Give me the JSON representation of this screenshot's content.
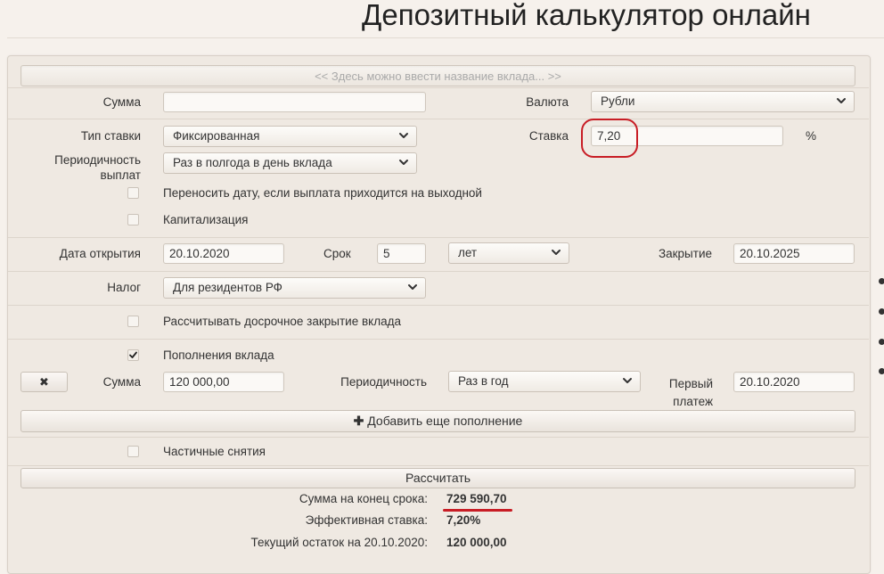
{
  "page": {
    "title": "Депозитный калькулятор онлайн"
  },
  "deposit_name": {
    "placeholder": "<< Здесь можно ввести название вклада... >>"
  },
  "sum": {
    "label": "Сумма",
    "value": ""
  },
  "currency": {
    "label": "Валюта",
    "value": "Рубли"
  },
  "rate_type": {
    "label": "Тип ставки",
    "value": "Фиксированная"
  },
  "rate": {
    "label": "Ставка",
    "value": "7,20",
    "unit": "%"
  },
  "payout": {
    "label_line1": "Периодичность",
    "label_line2": "выплат",
    "value": "Раз в полгода в день вклада"
  },
  "move_date": {
    "label": "Переносить дату, если выплата приходится на выходной",
    "checked": false
  },
  "capitalization": {
    "label": "Капитализация",
    "checked": false
  },
  "open_date": {
    "label": "Дата открытия",
    "value": "20.10.2020"
  },
  "term": {
    "label": "Срок",
    "value": "5",
    "unit": "лет"
  },
  "close_date": {
    "label": "Закрытие",
    "value": "20.10.2025"
  },
  "tax": {
    "label": "Налог",
    "value": "Для резидентов РФ"
  },
  "early_close": {
    "label": "Рассчитывать досрочное закрытие вклада",
    "checked": false
  },
  "topups": {
    "label": "Пополнения вклада",
    "checked": true,
    "sum_label": "Сумма",
    "sum_value": "120 000,00",
    "period_label": "Периодичность",
    "period_value": "Раз в год",
    "first_label_line1": "Первый",
    "first_label_line2": "платеж",
    "first_value": "20.10.2020",
    "remove_glyph": "✖",
    "add_label": "Добавить еще пополнение",
    "add_glyph": "✚"
  },
  "withdrawals": {
    "label": "Частичные снятия",
    "checked": false
  },
  "calculate": {
    "label": "Рассчитать"
  },
  "results": {
    "total_label": "Сумма на конец срока:",
    "total_value": "729 590,70",
    "eff_label": "Эффективная ставка:",
    "eff_value": "7,20%",
    "balance_label": "Текущий остаток на 20.10.2020:",
    "balance_value": "120 000,00"
  },
  "colors": {
    "highlight": "#c81d25",
    "panel": "#efe9e2",
    "background": "#f6f1ec"
  },
  "icons": {
    "select_arrow": "chevron-down-icon",
    "remove": "close-icon",
    "add": "plus-icon",
    "check": "checkmark-icon"
  }
}
